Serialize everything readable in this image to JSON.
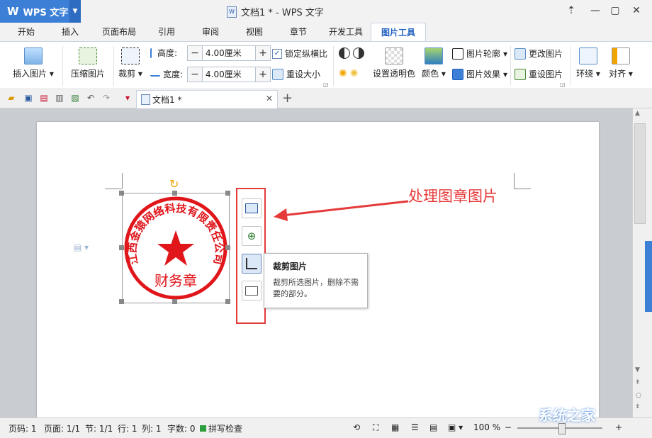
{
  "app": {
    "logo": "W",
    "name": "WPS 文字"
  },
  "window": {
    "title": "文档1 * - WPS 文字"
  },
  "tabs": [
    "开始",
    "插入",
    "页面布局",
    "引用",
    "审阅",
    "视图",
    "章节",
    "开发工具",
    "图片工具"
  ],
  "active_tab": "图片工具",
  "ribbon": {
    "insert_picture": "插入图片",
    "compress_picture": "压缩图片",
    "crop": "裁剪",
    "height_label": "高度:",
    "height_value": "4.00厘米",
    "width_label": "宽度:",
    "width_value": "4.00厘米",
    "lock_ratio": "锁定纵横比",
    "reset_size": "重设大小",
    "set_transparent": "设置透明色",
    "color": "颜色",
    "picture_outline": "图片轮廓",
    "picture_effect": "图片效果",
    "change_picture": "更改图片",
    "reset_picture": "重设图片",
    "wrap": "环绕",
    "align": "对齐"
  },
  "doc_tab": {
    "label": "文档1 *"
  },
  "stamp": {
    "ring_text": "江西金猿网络科技有限责任公司",
    "center_text": "财务章",
    "color": "#e0161b"
  },
  "annotation": {
    "text": "处理图章图片",
    "color": "#e53a3a"
  },
  "tooltip": {
    "title": "裁剪图片",
    "body": "裁剪所选图片，删除不需要的部分。"
  },
  "status": {
    "page": "页码: 1",
    "pages": "页面: 1/1",
    "section": "节: 1/1",
    "row": "行: 1",
    "col": "列: 1",
    "words": "字数: 0",
    "spellcheck": "拼写检查",
    "zoom": "100 %"
  },
  "watermark": "系统之家",
  "colors": {
    "accent": "#3b7fd6",
    "highlight": "#e53a3a"
  }
}
